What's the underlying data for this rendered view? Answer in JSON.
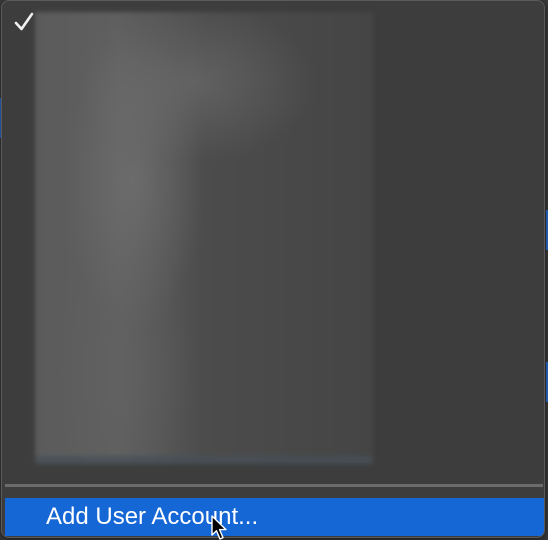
{
  "menu": {
    "checked_item_icon": "checkmark-icon",
    "redacted_content": true,
    "items": [
      {
        "label": "Add User Account...",
        "highlighted": true
      }
    ]
  },
  "cursor": {
    "icon": "arrow-pointer-icon"
  },
  "colors": {
    "menu_background": "#3d3d3d",
    "highlight": "#1667d6",
    "separator": "#6b6b6b",
    "text": "#ffffff"
  }
}
